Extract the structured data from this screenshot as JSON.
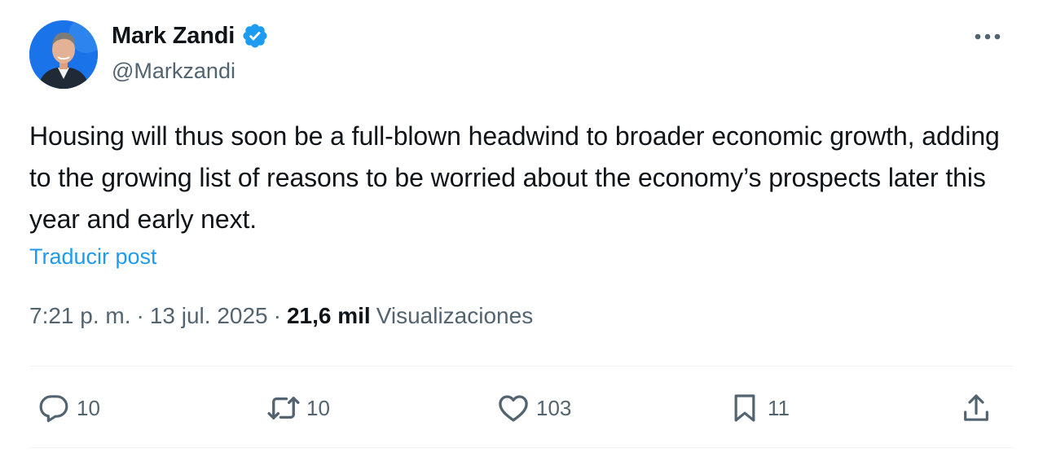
{
  "author": {
    "name": "Mark Zandi",
    "handle": "@Markzandi",
    "verified": true,
    "verified_color": "#1d9bf0"
  },
  "post": {
    "text": "Housing will thus soon be a full-blown headwind to broader economic growth, adding to the growing list of reasons to be worried about the economy’s prospects later this year and early next.",
    "translate_label": "Traducir post"
  },
  "meta": {
    "time": "7:21 p. m.",
    "separator": "·",
    "date": "13 jul. 2025",
    "views_count": "21,6 mil",
    "views_label": "Visualizaciones"
  },
  "actions": {
    "reply": {
      "icon": "reply-icon",
      "count": "10"
    },
    "repost": {
      "icon": "repost-icon",
      "count": "10"
    },
    "like": {
      "icon": "heart-icon",
      "count": "103"
    },
    "bookmark": {
      "icon": "bookmark-icon",
      "count": "11"
    },
    "share": {
      "icon": "share-icon"
    }
  },
  "colors": {
    "accent": "#1d9bf0",
    "text": "#0f1419",
    "secondary": "#536471",
    "divider": "#eff3f4"
  }
}
